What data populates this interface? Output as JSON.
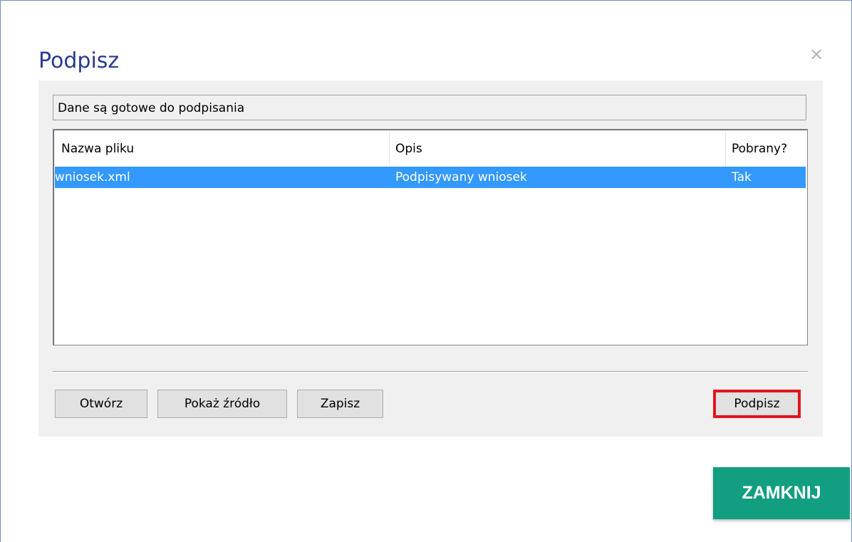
{
  "dialog": {
    "title": "Podpisz",
    "close_glyph": "✕",
    "status_text": "Dane są gotowe do podpisania"
  },
  "file_list": {
    "columns": [
      "Nazwa pliku",
      "Opis",
      "Pobrany?"
    ],
    "rows": [
      {
        "name": "wniosek.xml",
        "description": "Podpisywany wniosek",
        "downloaded": "Tak"
      }
    ]
  },
  "buttons": {
    "open": "Otwórz",
    "show_source": "Pokaż źródło",
    "save": "Zapisz",
    "sign": "Podpisz",
    "close": "ZAMKNIJ"
  },
  "colors": {
    "title": "#2b3a8f",
    "selection": "#3399ff",
    "highlight_border": "#e3141e",
    "close_button": "#129e80"
  },
  "icons": {
    "close": "close-icon"
  }
}
